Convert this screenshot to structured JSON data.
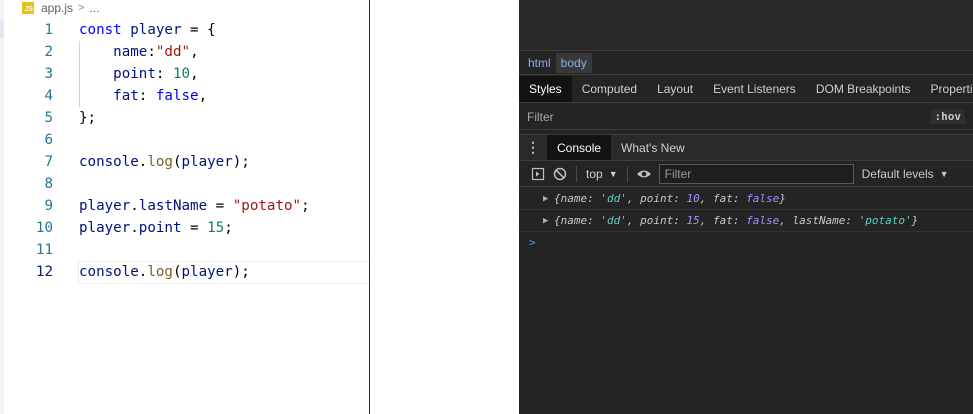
{
  "editor": {
    "breadcrumb": {
      "file_icon": "JS",
      "file_name": "app.js",
      "separator": ">",
      "more": "..."
    },
    "lines": [
      {
        "num": "1",
        "tokens": [
          [
            "k",
            "const"
          ],
          [
            "p",
            " "
          ],
          [
            "v",
            "player"
          ],
          [
            "p",
            " = {"
          ]
        ]
      },
      {
        "num": "2",
        "tokens": [
          [
            "p",
            "    "
          ],
          [
            "v",
            "name"
          ],
          [
            "p",
            ":"
          ],
          [
            "s",
            "\"dd\""
          ],
          [
            "p",
            ","
          ]
        ]
      },
      {
        "num": "3",
        "tokens": [
          [
            "p",
            "    "
          ],
          [
            "v",
            "point"
          ],
          [
            "p",
            ": "
          ],
          [
            "n",
            "10"
          ],
          [
            "p",
            ","
          ]
        ]
      },
      {
        "num": "4",
        "tokens": [
          [
            "p",
            "    "
          ],
          [
            "v",
            "fat"
          ],
          [
            "p",
            ": "
          ],
          [
            "k",
            "false"
          ],
          [
            "p",
            ","
          ]
        ]
      },
      {
        "num": "5",
        "tokens": [
          [
            "p",
            "};"
          ]
        ]
      },
      {
        "num": "6",
        "tokens": []
      },
      {
        "num": "7",
        "tokens": [
          [
            "v",
            "console"
          ],
          [
            "p",
            "."
          ],
          [
            "f",
            "log"
          ],
          [
            "p",
            "("
          ],
          [
            "v",
            "player"
          ],
          [
            "p",
            ");"
          ]
        ]
      },
      {
        "num": "8",
        "tokens": []
      },
      {
        "num": "9",
        "tokens": [
          [
            "v",
            "player"
          ],
          [
            "p",
            "."
          ],
          [
            "v",
            "lastName"
          ],
          [
            "p",
            " = "
          ],
          [
            "s",
            "\"potato\""
          ],
          [
            "p",
            ";"
          ]
        ]
      },
      {
        "num": "10",
        "tokens": [
          [
            "v",
            "player"
          ],
          [
            "p",
            "."
          ],
          [
            "v",
            "point"
          ],
          [
            "p",
            " = "
          ],
          [
            "n",
            "15"
          ],
          [
            "p",
            ";"
          ]
        ]
      },
      {
        "num": "11",
        "tokens": []
      },
      {
        "num": "12",
        "tokens": [
          [
            "v",
            "console"
          ],
          [
            "p",
            "."
          ],
          [
            "f",
            "log"
          ],
          [
            "p",
            "("
          ],
          [
            "v",
            "player"
          ],
          [
            "p",
            ");"
          ]
        ]
      }
    ],
    "current_line": "12"
  },
  "devtools": {
    "breadcrumbs": [
      "html",
      "body"
    ],
    "selected_breadcrumb": "body",
    "panel_tabs": [
      "Styles",
      "Computed",
      "Layout",
      "Event Listeners",
      "DOM Breakpoints",
      "Properties"
    ],
    "active_panel_tab": "Styles",
    "styles_filter_placeholder": "Filter",
    "hov_label": ":hov",
    "drawer_tabs": [
      "Console",
      "What's New"
    ],
    "active_drawer_tab": "Console",
    "console_toolbar": {
      "context": "top",
      "filter_placeholder": "Filter",
      "levels": "Default levels"
    },
    "console_logs": [
      {
        "tokens": [
          [
            "pk",
            "{name: "
          ],
          [
            "ps",
            "'dd'"
          ],
          [
            "pk",
            ", point: "
          ],
          [
            "pn",
            "10"
          ],
          [
            "pk",
            ", fat: "
          ],
          [
            "pb",
            "false"
          ],
          [
            "pk",
            "}"
          ]
        ]
      },
      {
        "tokens": [
          [
            "pk",
            "{name: "
          ],
          [
            "ps",
            "'dd'"
          ],
          [
            "pk",
            ", point: "
          ],
          [
            "pn",
            "15"
          ],
          [
            "pk",
            ", fat: "
          ],
          [
            "pb",
            "false"
          ],
          [
            "pk",
            ", lastName: "
          ],
          [
            "ps",
            "'potato'"
          ],
          [
            "pk",
            "}"
          ]
        ]
      }
    ],
    "prompt_symbol": ">"
  }
}
